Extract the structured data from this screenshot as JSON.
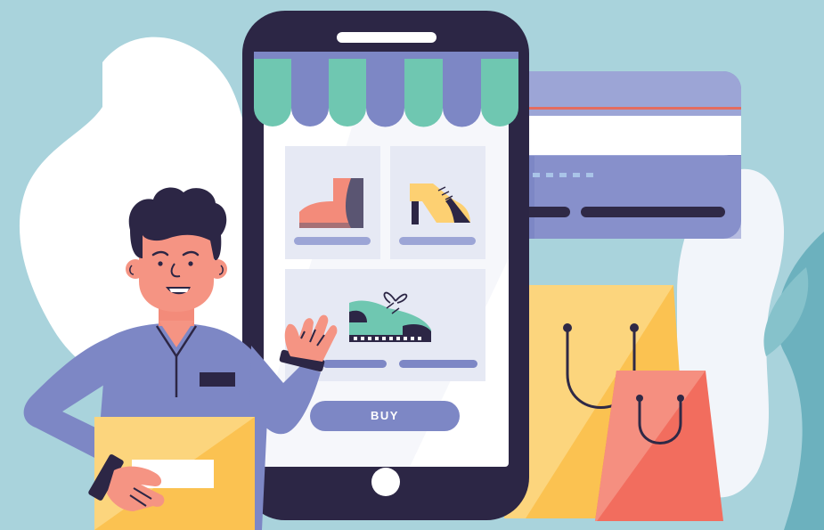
{
  "illustration": {
    "buy_button_label": "BUY"
  }
}
